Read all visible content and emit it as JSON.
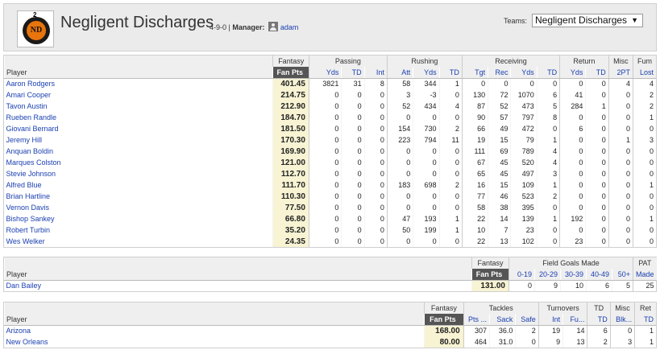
{
  "header": {
    "logo_text": "ND",
    "logo_number": "2",
    "team_name": "Negligent Discharges",
    "record": "4-9-0",
    "manager_label": "Manager:",
    "manager_name": "adam",
    "teams_label": "Teams:",
    "teams_selected": "Negligent Discharges",
    "colors": {
      "header_bg": "#ebebeb",
      "link": "#1a3fb0",
      "fan_pts_header": "#555555",
      "fan_pts_cell": "#f7f3d3",
      "logo_orange": "#e8740c"
    }
  },
  "offense": {
    "groups": [
      "Fantasy",
      "Passing",
      "Rushing",
      "Receiving",
      "Return",
      "Misc",
      "Fum"
    ],
    "columns": [
      "Player",
      "Fan Pts",
      "Yds",
      "TD",
      "Int",
      "Att",
      "Yds",
      "TD",
      "Tgt",
      "Rec",
      "Yds",
      "TD",
      "Yds",
      "TD",
      "2PT",
      "Lost"
    ],
    "rows": [
      [
        "Aaron Rodgers",
        "401.45",
        "3821",
        "31",
        "8",
        "58",
        "344",
        "1",
        "0",
        "0",
        "0",
        "0",
        "0",
        "0",
        "4",
        "4"
      ],
      [
        "Amari Cooper",
        "214.75",
        "0",
        "0",
        "0",
        "3",
        "-3",
        "0",
        "130",
        "72",
        "1070",
        "6",
        "41",
        "0",
        "0",
        "2"
      ],
      [
        "Tavon Austin",
        "212.90",
        "0",
        "0",
        "0",
        "52",
        "434",
        "4",
        "87",
        "52",
        "473",
        "5",
        "284",
        "1",
        "0",
        "2"
      ],
      [
        "Rueben Randle",
        "184.70",
        "0",
        "0",
        "0",
        "0",
        "0",
        "0",
        "90",
        "57",
        "797",
        "8",
        "0",
        "0",
        "0",
        "1"
      ],
      [
        "Giovani Bernard",
        "181.50",
        "0",
        "0",
        "0",
        "154",
        "730",
        "2",
        "66",
        "49",
        "472",
        "0",
        "6",
        "0",
        "0",
        "0"
      ],
      [
        "Jeremy Hill",
        "170.30",
        "0",
        "0",
        "0",
        "223",
        "794",
        "11",
        "19",
        "15",
        "79",
        "1",
        "0",
        "0",
        "1",
        "3"
      ],
      [
        "Anquan Boldin",
        "169.90",
        "0",
        "0",
        "0",
        "0",
        "0",
        "0",
        "111",
        "69",
        "789",
        "4",
        "0",
        "0",
        "0",
        "0"
      ],
      [
        "Marques Colston",
        "121.00",
        "0",
        "0",
        "0",
        "0",
        "0",
        "0",
        "67",
        "45",
        "520",
        "4",
        "0",
        "0",
        "0",
        "0"
      ],
      [
        "Stevie Johnson",
        "112.70",
        "0",
        "0",
        "0",
        "0",
        "0",
        "0",
        "65",
        "45",
        "497",
        "3",
        "0",
        "0",
        "0",
        "0"
      ],
      [
        "Alfred Blue",
        "111.70",
        "0",
        "0",
        "0",
        "183",
        "698",
        "2",
        "16",
        "15",
        "109",
        "1",
        "0",
        "0",
        "0",
        "1"
      ],
      [
        "Brian Hartline",
        "110.30",
        "0",
        "0",
        "0",
        "0",
        "0",
        "0",
        "77",
        "46",
        "523",
        "2",
        "0",
        "0",
        "0",
        "0"
      ],
      [
        "Vernon Davis",
        "77.50",
        "0",
        "0",
        "0",
        "0",
        "0",
        "0",
        "58",
        "38",
        "395",
        "0",
        "0",
        "0",
        "0",
        "0"
      ],
      [
        "Bishop Sankey",
        "66.80",
        "0",
        "0",
        "0",
        "47",
        "193",
        "1",
        "22",
        "14",
        "139",
        "1",
        "192",
        "0",
        "0",
        "1"
      ],
      [
        "Robert Turbin",
        "35.20",
        "0",
        "0",
        "0",
        "50",
        "199",
        "1",
        "10",
        "7",
        "23",
        "0",
        "0",
        "0",
        "0",
        "0"
      ],
      [
        "Wes Welker",
        "24.35",
        "0",
        "0",
        "0",
        "0",
        "0",
        "0",
        "22",
        "13",
        "102",
        "0",
        "23",
        "0",
        "0",
        "0"
      ]
    ]
  },
  "kicker": {
    "groups": [
      "Fantasy",
      "Field Goals Made",
      "PAT"
    ],
    "columns": [
      "Player",
      "Fan Pts",
      "0-19",
      "20-29",
      "30-39",
      "40-49",
      "50+",
      "Made"
    ],
    "rows": [
      [
        "Dan Bailey",
        "131.00",
        "0",
        "9",
        "10",
        "6",
        "5",
        "25"
      ]
    ]
  },
  "defense": {
    "groups": [
      "Fantasy",
      "Tackles",
      "Turnovers",
      "TD",
      "Misc",
      "Ret"
    ],
    "columns": [
      "Player",
      "Fan Pts",
      "Pts ...",
      "Sack",
      "Safe",
      "Int",
      "Fu...",
      "TD",
      "Blk...",
      "TD"
    ],
    "rows": [
      [
        "Arizona",
        "168.00",
        "307",
        "36.0",
        "2",
        "19",
        "14",
        "6",
        "0",
        "1"
      ],
      [
        "New Orleans",
        "80.00",
        "464",
        "31.0",
        "0",
        "9",
        "13",
        "2",
        "3",
        "1"
      ]
    ]
  }
}
